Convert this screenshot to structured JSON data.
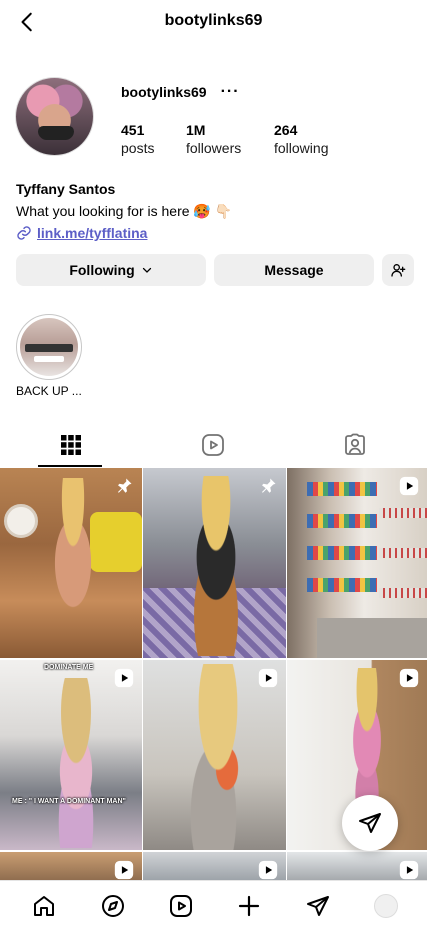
{
  "header": {
    "title": "bootylinks69"
  },
  "profile": {
    "username": "bootylinks69",
    "more": "···",
    "stats": [
      {
        "value": "451",
        "label": "posts"
      },
      {
        "value": "1M",
        "label": "followers"
      },
      {
        "value": "264",
        "label": "following"
      }
    ],
    "full_name": "Tyffany Santos",
    "bio": "What you looking for is here 🥵 👇🏻",
    "link": "link.me/tyfflatina"
  },
  "actions": {
    "following_label": "Following",
    "message_label": "Message"
  },
  "highlights": [
    {
      "label": "BACK UP ..."
    }
  ],
  "posts": [
    {
      "type": "pinned-photo"
    },
    {
      "type": "pinned-photo"
    },
    {
      "type": "reel"
    },
    {
      "type": "reel",
      "caption_top": "DOMINATE ME",
      "caption_bottom": "ME : \" I WANT A DOMINANT MAN\""
    },
    {
      "type": "reel"
    },
    {
      "type": "reel"
    },
    {
      "type": "reel"
    },
    {
      "type": "reel"
    },
    {
      "type": "reel"
    }
  ],
  "icons": {
    "back": "chevron-left-icon",
    "grid_tab": "grid-icon",
    "reels_tab": "reels-icon",
    "tagged_tab": "tagged-user-icon",
    "nav": [
      "home-icon",
      "explore-icon",
      "reels-icon",
      "plus-icon",
      "send-icon",
      "profile-avatar"
    ]
  },
  "colors": {
    "link": "#5c5ec7",
    "button_bg": "#efefef"
  }
}
